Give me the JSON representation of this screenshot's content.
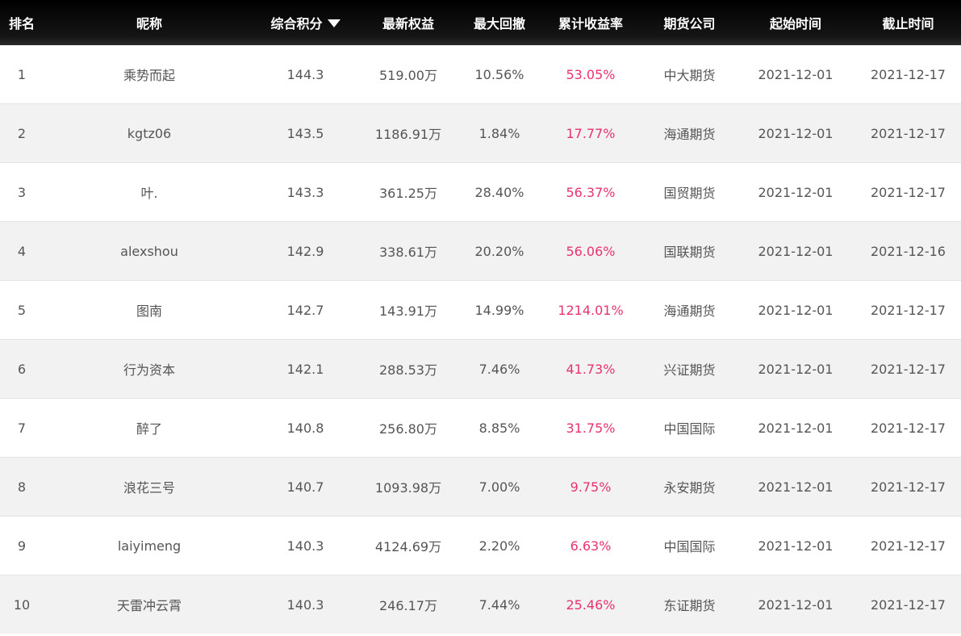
{
  "headers": {
    "rank": "排名",
    "nickname": "昵称",
    "score": "综合积分",
    "equity": "最新权益",
    "drawdown": "最大回撤",
    "return": "累计收益率",
    "company": "期货公司",
    "start": "起始时间",
    "end": "截止时间"
  },
  "sort_icon": "triangle-down-icon",
  "colors": {
    "header_bg": "#000000",
    "return_text": "#e8336e",
    "row_alt": "#f2f2f2"
  },
  "rows": [
    {
      "rank": "1",
      "nickname": "乘势而起",
      "score": "144.3",
      "equity": "519.00万",
      "drawdown": "10.56%",
      "return": "53.05%",
      "company": "中大期货",
      "start": "2021-12-01",
      "end": "2021-12-17"
    },
    {
      "rank": "2",
      "nickname": "kgtz06",
      "score": "143.5",
      "equity": "1186.91万",
      "drawdown": "1.84%",
      "return": "17.77%",
      "company": "海通期货",
      "start": "2021-12-01",
      "end": "2021-12-17"
    },
    {
      "rank": "3",
      "nickname": "叶.",
      "score": "143.3",
      "equity": "361.25万",
      "drawdown": "28.40%",
      "return": "56.37%",
      "company": "国贸期货",
      "start": "2021-12-01",
      "end": "2021-12-17"
    },
    {
      "rank": "4",
      "nickname": "alexshou",
      "score": "142.9",
      "equity": "338.61万",
      "drawdown": "20.20%",
      "return": "56.06%",
      "company": "国联期货",
      "start": "2021-12-01",
      "end": "2021-12-16"
    },
    {
      "rank": "5",
      "nickname": "图南",
      "score": "142.7",
      "equity": "143.91万",
      "drawdown": "14.99%",
      "return": "1214.01%",
      "company": "海通期货",
      "start": "2021-12-01",
      "end": "2021-12-17"
    },
    {
      "rank": "6",
      "nickname": "行为资本",
      "score": "142.1",
      "equity": "288.53万",
      "drawdown": "7.46%",
      "return": "41.73%",
      "company": "兴证期货",
      "start": "2021-12-01",
      "end": "2021-12-17"
    },
    {
      "rank": "7",
      "nickname": "醉了",
      "score": "140.8",
      "equity": "256.80万",
      "drawdown": "8.85%",
      "return": "31.75%",
      "company": "中国国际",
      "start": "2021-12-01",
      "end": "2021-12-17"
    },
    {
      "rank": "8",
      "nickname": "浪花三号",
      "score": "140.7",
      "equity": "1093.98万",
      "drawdown": "7.00%",
      "return": "9.75%",
      "company": "永安期货",
      "start": "2021-12-01",
      "end": "2021-12-17"
    },
    {
      "rank": "9",
      "nickname": "laiyimeng",
      "score": "140.3",
      "equity": "4124.69万",
      "drawdown": "2.20%",
      "return": "6.63%",
      "company": "中国国际",
      "start": "2021-12-01",
      "end": "2021-12-17"
    },
    {
      "rank": "10",
      "nickname": "天雷冲云霄",
      "score": "140.3",
      "equity": "246.17万",
      "drawdown": "7.44%",
      "return": "25.46%",
      "company": "东证期货",
      "start": "2021-12-01",
      "end": "2021-12-17"
    }
  ]
}
